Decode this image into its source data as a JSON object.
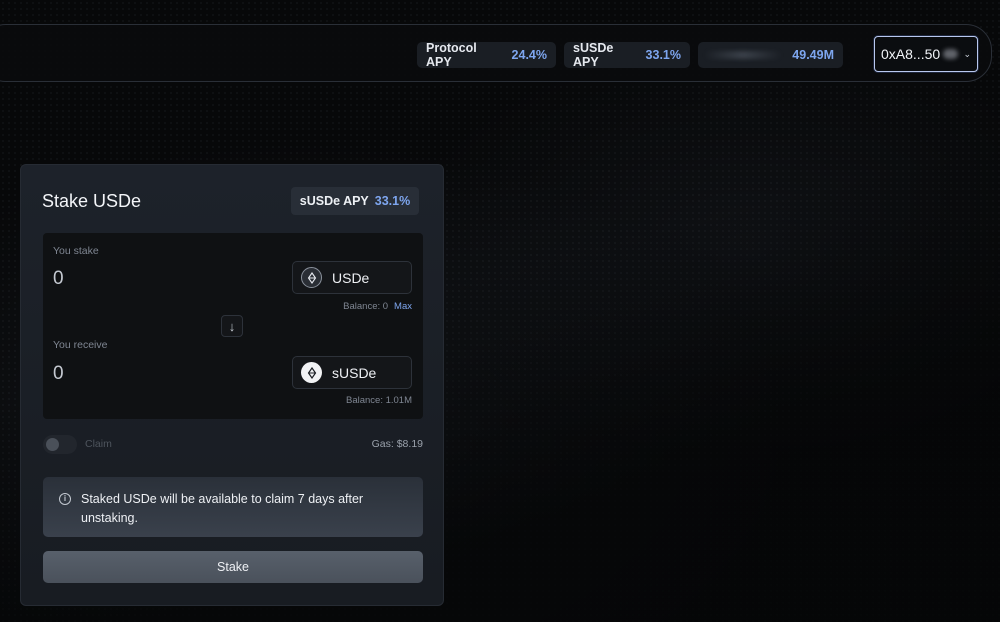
{
  "header": {
    "protocol_apy_label": "Protocol APY",
    "protocol_apy_value": "24.4%",
    "susde_apy_label": "sUSDe APY",
    "susde_apy_value": "33.1%",
    "tvl_value": "49.49M",
    "wallet_address": "0xA8...50"
  },
  "stake": {
    "title": "Stake USDe",
    "apy_label": "sUSDe APY",
    "apy_value": "33.1%",
    "you_stake_label": "You stake",
    "stake_amount": "0",
    "stake_token": "USDe",
    "stake_balance": "Balance: 0",
    "max_label": "Max",
    "you_receive_label": "You receive",
    "receive_amount": "0",
    "receive_token": "sUSDe",
    "receive_balance": "Balance: 1.01M",
    "claim_label": "Claim",
    "claim_enabled": false,
    "gas_label": "Gas: $8.19",
    "notice": "Staked USDe will be available to claim 7 days after unstaking.",
    "stake_button": "Stake"
  },
  "icons": {
    "swap_direction": "arrow-down-icon",
    "info": "info-icon",
    "token": "ethena-token-icon",
    "wallet_chevron": "chevron-down-icon"
  },
  "colors": {
    "accent": "#7ea6ef",
    "background": "#070809",
    "card": "#1d222a"
  }
}
